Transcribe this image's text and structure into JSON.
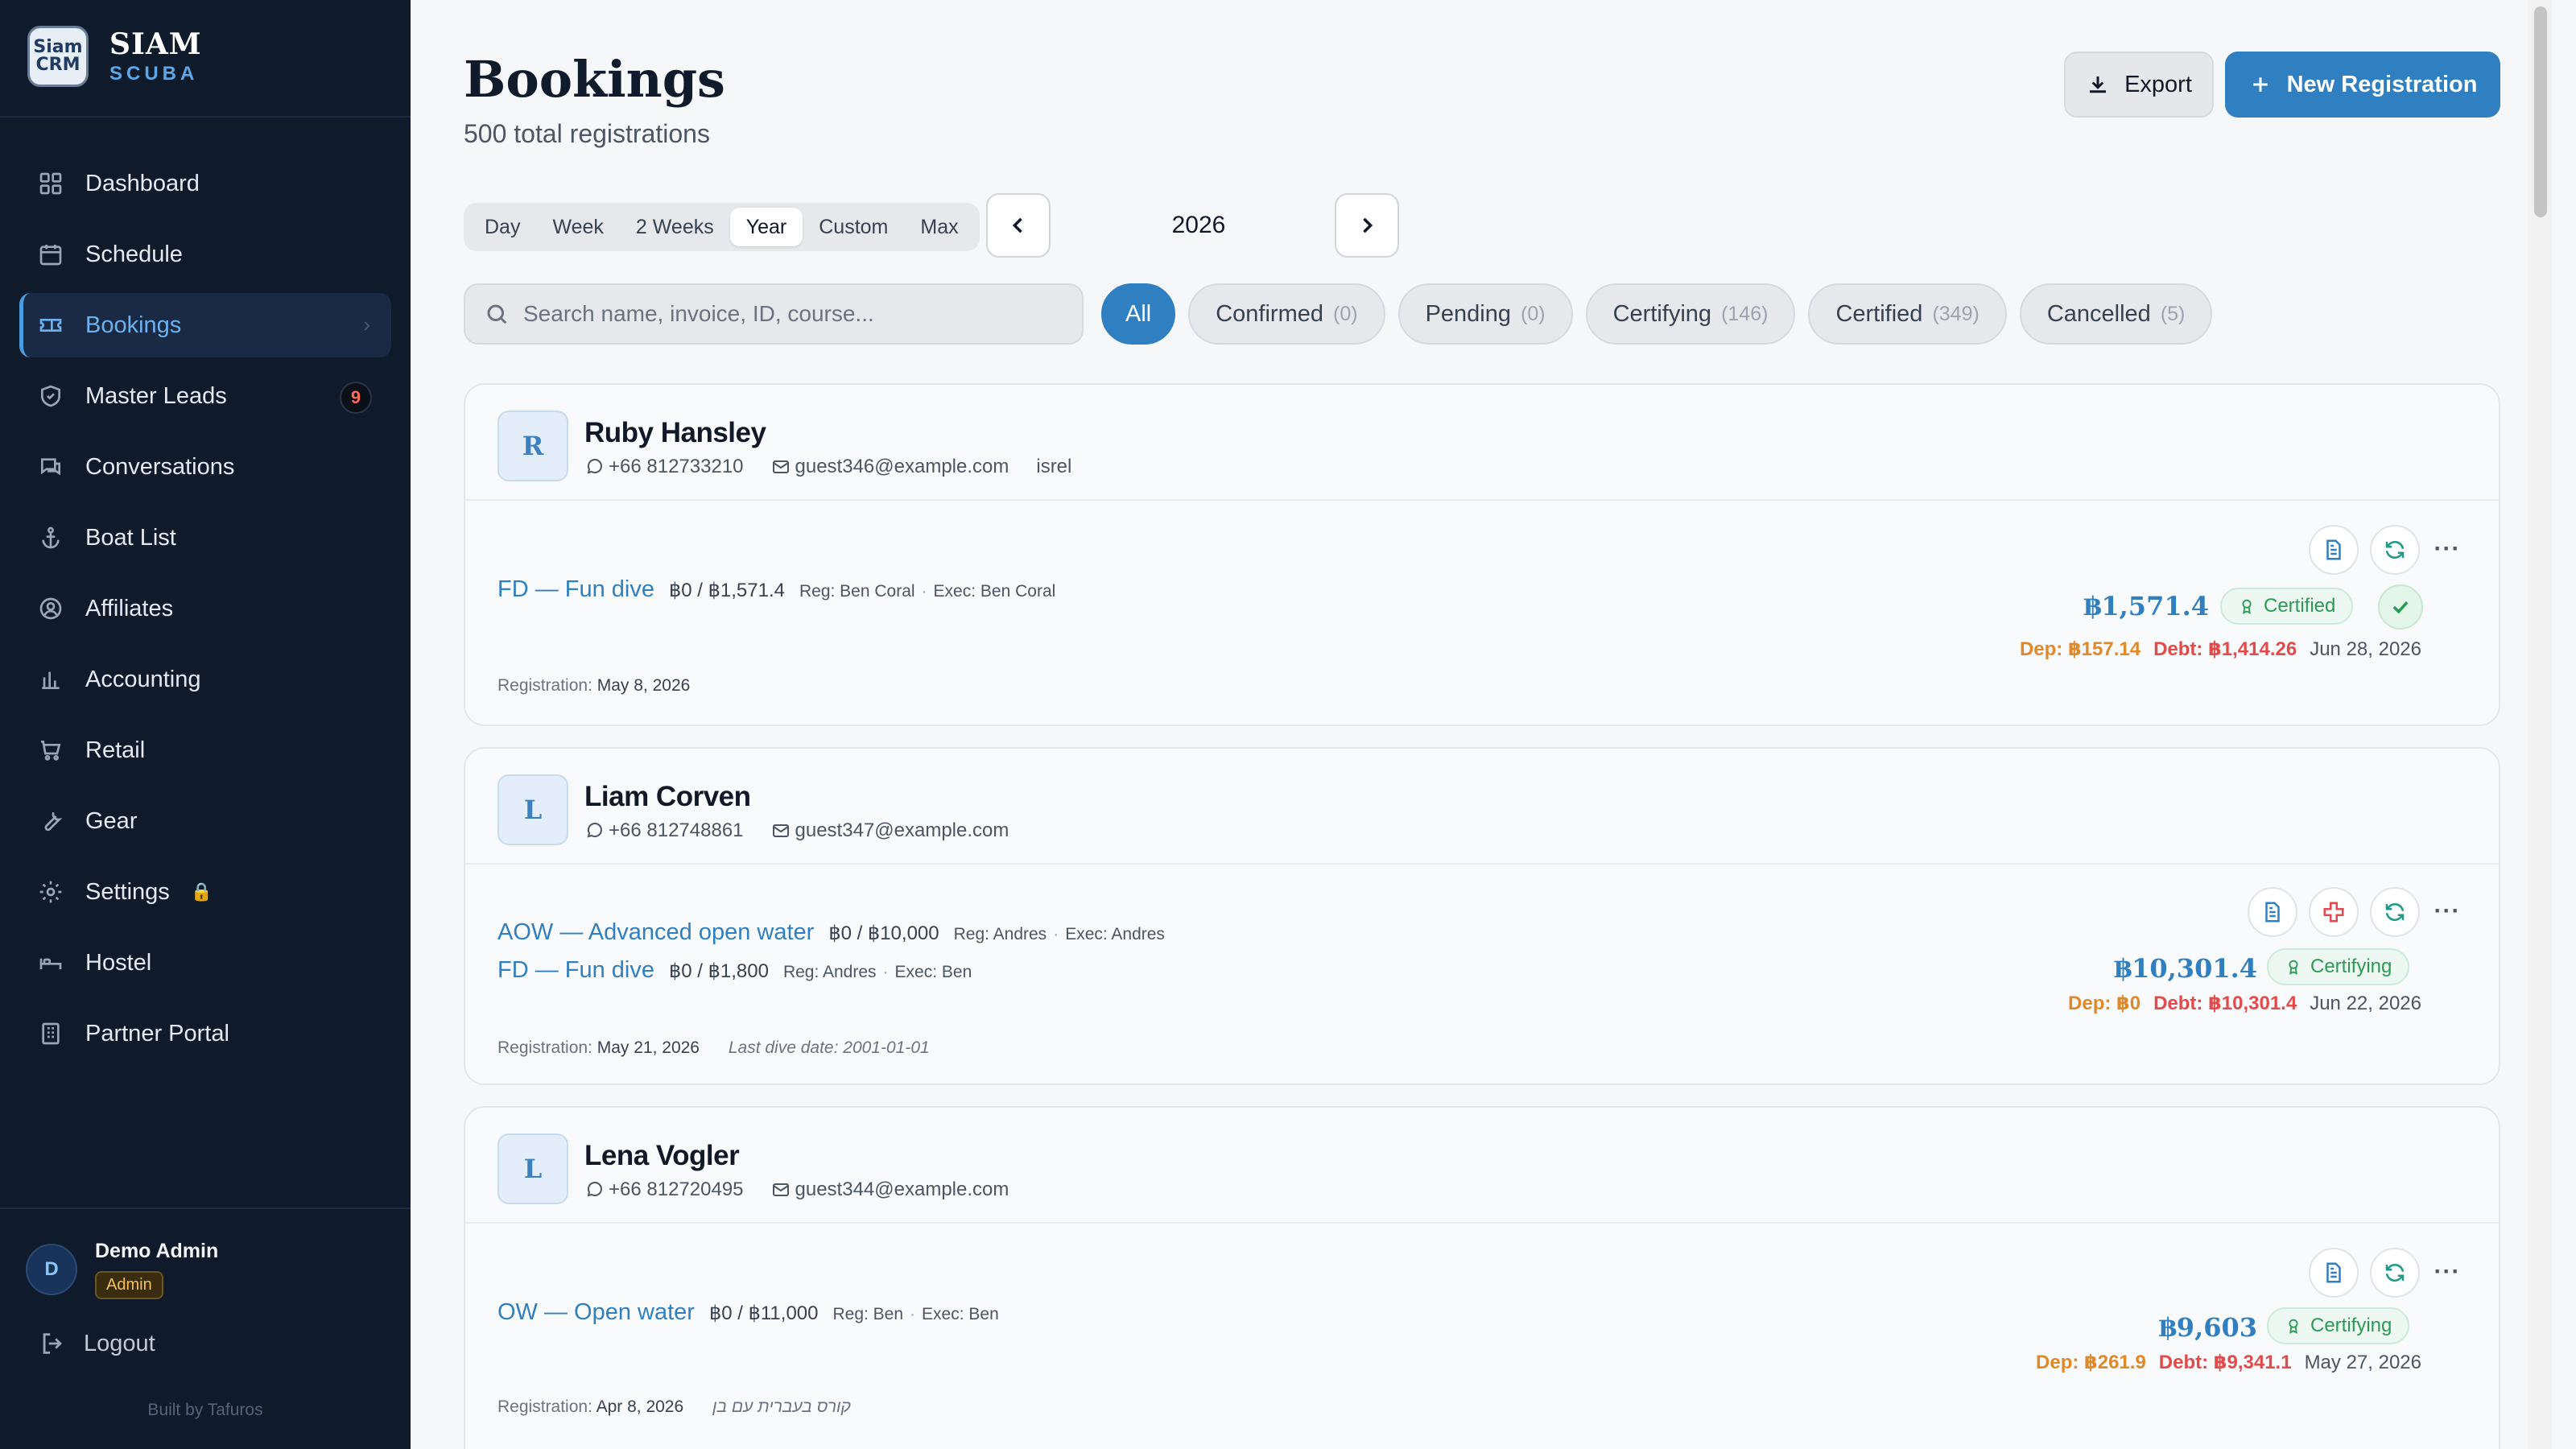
{
  "brand": {
    "logo_text": "Siam CRM",
    "name": "SIAM",
    "sub": "SCUBA"
  },
  "sidebar": {
    "items": [
      {
        "label": "Dashboard"
      },
      {
        "label": "Schedule"
      },
      {
        "label": "Bookings"
      },
      {
        "label": "Master Leads",
        "badge": "9"
      },
      {
        "label": "Conversations"
      },
      {
        "label": "Boat List"
      },
      {
        "label": "Affiliates"
      },
      {
        "label": "Accounting"
      },
      {
        "label": "Retail"
      },
      {
        "label": "Gear"
      },
      {
        "label": "Settings"
      },
      {
        "label": "Hostel"
      },
      {
        "label": "Partner Portal"
      }
    ],
    "active_chevron": "›",
    "settings_lock": "🔒"
  },
  "user": {
    "initial": "D",
    "name": "Demo Admin",
    "role": "Admin"
  },
  "logout_label": "Logout",
  "built_by": "Built by Tafuros",
  "header": {
    "title": "Bookings",
    "subtitle": "500 total registrations",
    "export_label": "Export",
    "new_label": "New Registration"
  },
  "range": {
    "tabs": [
      "Day",
      "Week",
      "2 Weeks",
      "Year",
      "Custom",
      "Max"
    ],
    "active": "Year",
    "year": "2026"
  },
  "search": {
    "placeholder": "Search name, invoice, ID, course..."
  },
  "filters": [
    {
      "label": "All",
      "count": ""
    },
    {
      "label": "Confirmed",
      "count": "(0)"
    },
    {
      "label": "Pending",
      "count": "(0)"
    },
    {
      "label": "Certifying",
      "count": "(146)"
    },
    {
      "label": "Certified",
      "count": "(349)"
    },
    {
      "label": "Cancelled",
      "count": "(5)"
    }
  ],
  "bookings": [
    {
      "initial": "R",
      "name": "Ruby Hansley",
      "phone": "+66 812733210",
      "email": "guest346@example.com",
      "extra": "isrel",
      "courses": [
        {
          "name": "FD — Fun dive",
          "price": "฿0 / ฿1,571.4",
          "reg": "Reg: Ben Coral",
          "exec": "Exec: Ben Coral"
        }
      ],
      "total": "฿1,571.4",
      "status": "Certified",
      "dep": "Dep: ฿157.14",
      "debt": "Debt: ฿1,414.26",
      "date": "Jun 28, 2026",
      "registration_label": "Registration:",
      "registration_date": "May 8, 2026",
      "note": ""
    },
    {
      "initial": "L",
      "name": "Liam Corven",
      "phone": "+66 812748861",
      "email": "guest347@example.com",
      "extra": "",
      "courses": [
        {
          "name": "AOW — Advanced open water",
          "price": "฿0 / ฿10,000",
          "reg": "Reg: Andres",
          "exec": "Exec: Andres"
        },
        {
          "name": "FD — Fun dive",
          "price": "฿0 / ฿1,800",
          "reg": "Reg: Andres",
          "exec": "Exec: Ben"
        }
      ],
      "total": "฿10,301.4",
      "status": "Certifying",
      "dep": "Dep: ฿0",
      "debt": "Debt: ฿10,301.4",
      "date": "Jun 22, 2026",
      "registration_label": "Registration:",
      "registration_date": "May 21, 2026",
      "note": "Last dive date: 2001-01-01"
    },
    {
      "initial": "L",
      "name": "Lena Vogler",
      "phone": "+66 812720495",
      "email": "guest344@example.com",
      "extra": "",
      "courses": [
        {
          "name": "OW — Open water",
          "price": "฿0 / ฿11,000",
          "reg": "Reg: Ben",
          "exec": "Exec: Ben"
        }
      ],
      "total": "฿9,603",
      "status": "Certifying",
      "dep": "Dep: ฿261.9",
      "debt": "Debt: ฿9,341.1",
      "date": "May 27, 2026",
      "registration_label": "Registration:",
      "registration_date": "Apr 8, 2026",
      "note": "קורס בעברית עם בן"
    }
  ],
  "more_label": "···"
}
